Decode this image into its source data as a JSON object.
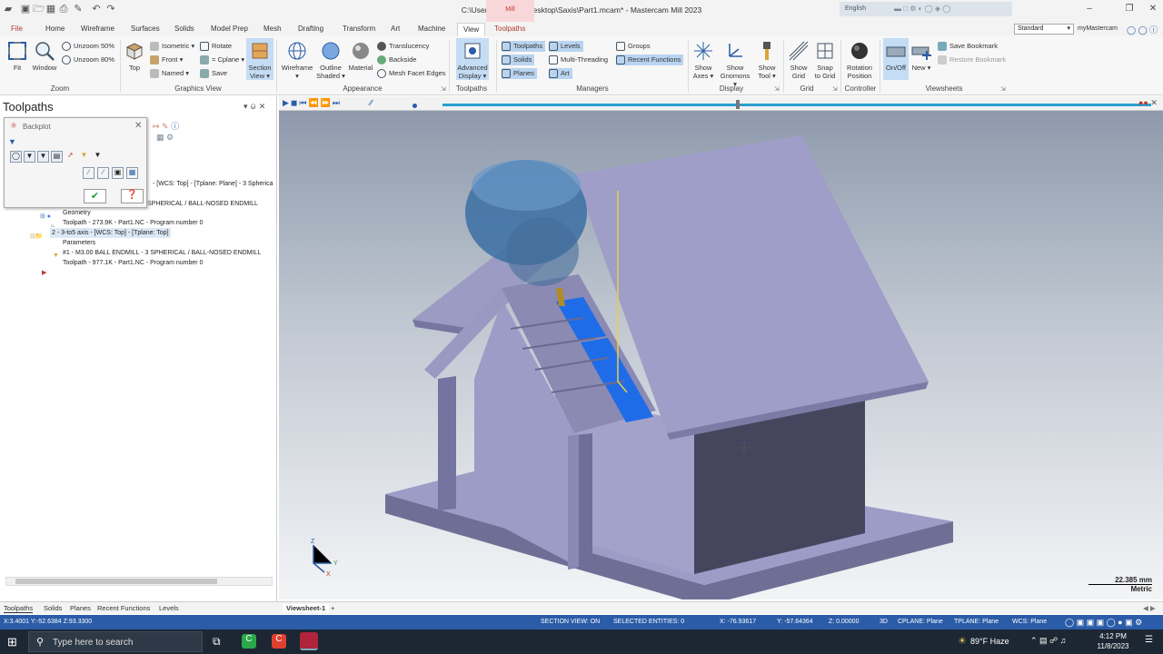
{
  "window": {
    "title": "C:\\Users\\md imam\\Desktop\\Saxis\\Part1.mcam* - Mastercam Mill 2023",
    "contextual_tab": "Mill",
    "language": "English"
  },
  "tabs": [
    "File",
    "Home",
    "Wireframe",
    "Surfaces",
    "Solids",
    "Model Prep",
    "Mesh",
    "Drafting",
    "Transform",
    "Art",
    "Machine",
    "View",
    "Toolpaths"
  ],
  "toolbar_right": {
    "workspace": "Standard",
    "mymastercam": "myMastercam"
  },
  "ribbon": {
    "zoom": {
      "label": "Zoom",
      "fit": "Fit",
      "window": "Window",
      "unzoom50": "Unzoom 50%",
      "unzoom80": "Unzoom 80%"
    },
    "graphics_view": {
      "label": "Graphics View",
      "top": "Top",
      "isometric": "Isometric",
      "front": "Front",
      "named": "Named",
      "rotate": "Rotate",
      "cplane": "= Cplane",
      "save": "Save",
      "section_view": "Section",
      "section_view2": "View"
    },
    "appearance": {
      "label": "Appearance",
      "wireframe": "Wireframe",
      "outline": "Outline",
      "outline2": "Shaded",
      "material": "Material",
      "translucency": "Translucency",
      "backside": "Backside",
      "mesh_facet": "Mesh Facet Edges"
    },
    "toolpaths": {
      "label": "Toolpaths",
      "advanced": "Advanced",
      "advanced2": "Display"
    },
    "managers": {
      "label": "Managers",
      "toolpaths": "Toolpaths",
      "solids": "Solids",
      "planes": "Planes",
      "levels": "Levels",
      "multithreading": "Multi-Threading",
      "art": "Art",
      "groups": "Groups",
      "recent": "Recent Functions"
    },
    "display": {
      "label": "Display",
      "show_axes": "Show",
      "show_axes2": "Axes",
      "show_gnomons": "Show",
      "show_gnomons2": "Gnomons",
      "show_tool": "Show",
      "show_tool2": "Tool"
    },
    "grid": {
      "label": "Grid",
      "show_grid": "Show",
      "show_grid2": "Grid",
      "snap": "Snap",
      "snap2": "to Grid"
    },
    "controller": {
      "label": "Controller",
      "rotation": "Rotation",
      "rotation2": "Position"
    },
    "viewsheets": {
      "label": "Viewsheets",
      "onoff": "On/Off",
      "new": "New",
      "save_bm": "Save Bookmark",
      "restore_bm": "Restore Bookmark"
    }
  },
  "left_panel": {
    "title": "Toolpaths",
    "backplot": {
      "title": "Backplot"
    },
    "tree": [
      "- [WCS: Top] - [Tplane: Plane] - 3 Spherica",
      "SPHERICAL / BALL-NOSED ENDMILL",
      "Geometry",
      "Toolpath - 273.9K - Part1.NC - Program number 0",
      "2 - 3-to5 axis - [WCS: Top] - [Tplane: Top]",
      "Parameters",
      "#1 - M3.00 BALL ENDMILL - 3 SPHERICAL / BALL-NOSED ENDMILL",
      "Toolpath - 977.1K - Part1.NC - Program number 0"
    ]
  },
  "bottom_tabs": [
    "Toolpaths",
    "Solids",
    "Planes",
    "Recent Functions",
    "Levels"
  ],
  "viewsheet": {
    "tab": "Viewsheet-1",
    "add": "+"
  },
  "scale": {
    "value": "22.385 mm",
    "unit": "Metric"
  },
  "status": {
    "coords": "X:3.4001   Y:-52.6384   Z:93.3300",
    "section": "SECTION VIEW: ON",
    "selected": "SELECTED ENTITIES: 0",
    "x": "X:    -76.93617",
    "y": "Y:    -57.64364",
    "z": "Z:    0.00000",
    "mode": "3D",
    "cplane": "CPLANE: Plane",
    "tplane": "TPLANE: Plane",
    "wcs": "WCS: Plane"
  },
  "taskbar": {
    "search": "Type here to search",
    "weather": "89°F  Haze",
    "time": "4:12 PM",
    "date": "11/8/2023"
  },
  "colors": {
    "status_bar": "#2a5ca8",
    "accent": "#b03a2e",
    "taskbar": "#1c2733"
  }
}
